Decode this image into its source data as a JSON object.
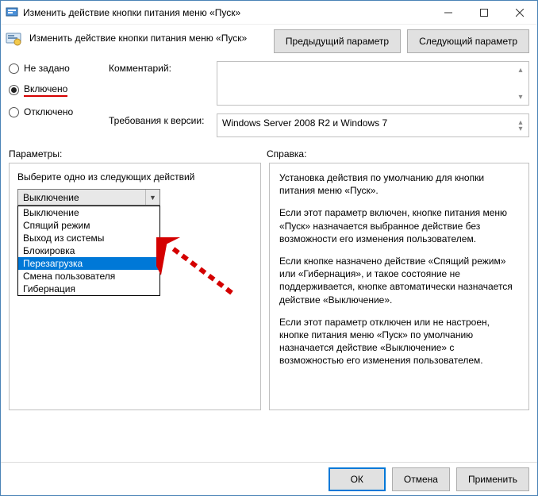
{
  "window": {
    "title": "Изменить действие кнопки питания меню «Пуск»"
  },
  "header": {
    "title": "Изменить действие кнопки питания меню «Пуск»",
    "prev": "Предыдущий параметр",
    "next": "Следующий параметр"
  },
  "state": {
    "not_configured": "Не задано",
    "enabled": "Включено",
    "disabled": "Отключено",
    "selected": "enabled"
  },
  "labels": {
    "comment": "Комментарий:",
    "supported": "Требования к версии:",
    "options": "Параметры:",
    "help": "Справка:"
  },
  "supported_text": "Windows Server 2008 R2 и Windows 7",
  "options": {
    "prompt": "Выберите одно из следующих действий",
    "selected": "Выключение",
    "items": {
      "0": "Выключение",
      "1": "Спящий режим",
      "2": "Выход из системы",
      "3": "Блокировка",
      "4": "Перезагрузка",
      "5": "Смена пользователя",
      "6": "Гибернация"
    },
    "highlighted_index": 4
  },
  "help": {
    "p1": "Установка действия по умолчанию для кнопки питания меню «Пуск».",
    "p2": "Если этот параметр включен, кнопке питания меню «Пуск» назначается выбранное действие без возможности его изменения пользователем.",
    "p3": "Если кнопке назначено действие «Спящий режим» или «Гибернация», и такое состояние не поддерживается, кнопке автоматически назначается действие «Выключение».",
    "p4": "Если этот параметр отключен или не настроен, кнопке питания меню «Пуск» по умолчанию назначается действие «Выключение» с возможностью его изменения пользователем."
  },
  "buttons": {
    "ok": "ОК",
    "cancel": "Отмена",
    "apply": "Применить"
  }
}
